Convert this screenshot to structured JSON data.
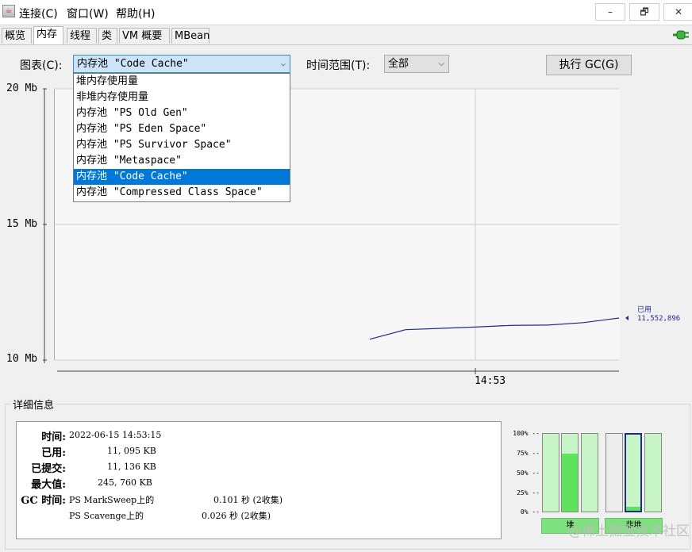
{
  "menubar": {
    "items": [
      "连接(C)",
      "窗口(W)",
      "帮助(H)"
    ],
    "window_buttons": [
      "–",
      "🗗",
      "✕"
    ]
  },
  "tabs": [
    "概览",
    "内存",
    "线程",
    "类",
    "VM 概要",
    "MBean"
  ],
  "active_tab": "内存",
  "controls": {
    "chart_label": "图表(C):",
    "chart_value": "内存池 \"Code Cache\"",
    "range_label": "时间范围(T):",
    "range_value": "全部",
    "gc_button": "执行 GC(G)"
  },
  "dropdown_options": [
    "堆内存使用量",
    "非堆内存使用量",
    "内存池 \"PS Old Gen\"",
    "内存池 \"PS Eden Space\"",
    "内存池 \"PS Survivor Space\"",
    "内存池 \"Metaspace\"",
    "内存池 \"Code Cache\"",
    "内存池 \"Compressed Class Space\""
  ],
  "dropdown_selected_index": 6,
  "chart_data": {
    "type": "line",
    "y_tick_labels": [
      "20 Mb",
      "15 Mb",
      "10 Mb"
    ],
    "y_ticks": [
      20,
      15,
      10
    ],
    "ylim": [
      10,
      20
    ],
    "x_tick_labels": [
      "14:53"
    ],
    "series": [
      {
        "name": "已用",
        "values": [
          10.77,
          11.12,
          11.17,
          11.22,
          11.28,
          11.29,
          11.38,
          11.55
        ]
      }
    ],
    "current_label": "已用",
    "current_value": "11,552,896",
    "grid": true
  },
  "details": {
    "title": "详细信息",
    "rows": [
      {
        "key": "时间:",
        "value": "2022-06-15 14:53:15"
      },
      {
        "key": "已用:",
        "value": "11, 095 KB"
      },
      {
        "key": "已提交:",
        "value": "11, 136 KB"
      },
      {
        "key": "最大值:",
        "value": "245, 760 KB"
      }
    ],
    "gc_key": "GC 时间:",
    "gc_rows": [
      {
        "name": "PS MarkSweep上的",
        "time": "0.101 秒 (2收集)"
      },
      {
        "name": "PS Scavenge上的",
        "time": "0.026 秒 (2收集)"
      }
    ]
  },
  "bars": {
    "pct_labels": [
      "100% --",
      "75% --",
      "50% --",
      "25% --",
      "0% --"
    ],
    "heap_fill": [
      0.0,
      0.74,
      0.0
    ],
    "nonheap_fill": [
      0.0,
      0.05,
      0.0
    ],
    "heap_label": "堆",
    "nonheap_label": "非堆"
  },
  "watermark": "@稀土掘金技术社区",
  "colors": {
    "series": "#1f2a8c",
    "selection": "#0078d7",
    "bar_fill": "#5fe35f",
    "bar_bg": "#c8f5c8"
  }
}
